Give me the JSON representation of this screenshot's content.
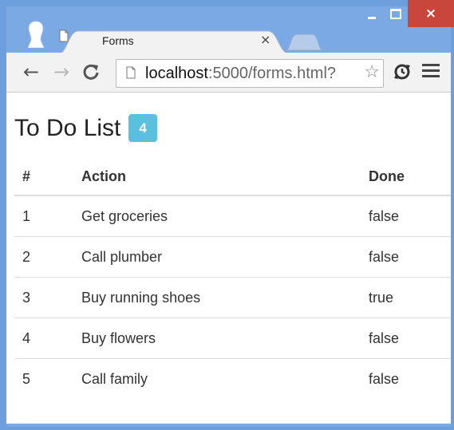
{
  "browser": {
    "tab_title": "Forms",
    "tab_close": "×",
    "url_host": "localhost",
    "url_rest": ":5000/forms.html?",
    "window_controls": {
      "close": "×"
    },
    "colors": {
      "frame": "#6e9fdd",
      "close": "#c9463d"
    }
  },
  "page": {
    "title": "To Do List",
    "badge_count": "4",
    "badge_color": "#5bc0de",
    "table": {
      "headers": [
        "#",
        "Action",
        "Done"
      ],
      "rows": [
        [
          "1",
          "Get groceries",
          "false"
        ],
        [
          "2",
          "Call plumber",
          "false"
        ],
        [
          "3",
          "Buy running shoes",
          "true"
        ],
        [
          "4",
          "Buy flowers",
          "false"
        ],
        [
          "5",
          "Call family",
          "false"
        ]
      ]
    }
  }
}
